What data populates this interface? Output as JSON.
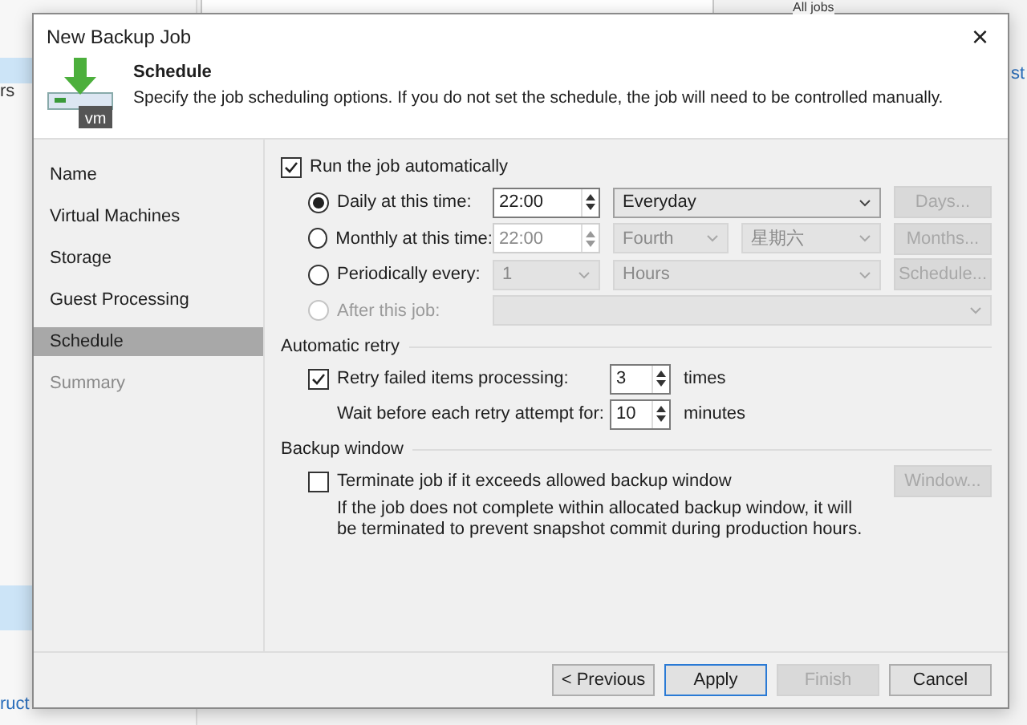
{
  "background": {
    "fragments": [
      {
        "text": "All jobs",
        "kind": "top"
      },
      {
        "text": "rs",
        "kind": "left"
      },
      {
        "text": "st",
        "kind": "right"
      },
      {
        "text": "ruct",
        "kind": "bottom"
      }
    ]
  },
  "window": {
    "title": "New Backup Job",
    "close": "×"
  },
  "header": {
    "logo_text": "vm",
    "title": "Schedule",
    "description": "Specify the job scheduling options. If you do not set the schedule, the job will need to be controlled manually."
  },
  "steps": [
    {
      "label": "Name",
      "selected": false,
      "disabled": false
    },
    {
      "label": "Virtual Machines",
      "selected": false,
      "disabled": false
    },
    {
      "label": "Storage",
      "selected": false,
      "disabled": false
    },
    {
      "label": "Guest Processing",
      "selected": false,
      "disabled": false
    },
    {
      "label": "Schedule",
      "selected": true,
      "disabled": false
    },
    {
      "label": "Summary",
      "selected": false,
      "disabled": true
    }
  ],
  "run_automatically": {
    "label": "Run the job automatically",
    "checked": true
  },
  "schedule_options": [
    {
      "label": "Daily at this time:",
      "selected": true,
      "disabled": false,
      "time": {
        "value": "22:00",
        "disabled": false
      },
      "combos": [
        {
          "value": "Everyday",
          "disabled": false
        }
      ],
      "button": {
        "label": "Days...",
        "disabled": true
      }
    },
    {
      "label": "Monthly at this time:",
      "selected": false,
      "disabled": false,
      "time": {
        "value": "22:00",
        "disabled": true
      },
      "combos": [
        {
          "value": "Fourth",
          "disabled": true
        },
        {
          "value": "星期六",
          "disabled": true
        }
      ],
      "button": {
        "label": "Months...",
        "disabled": true
      }
    },
    {
      "label": "Periodically every:",
      "selected": false,
      "disabled": false,
      "combos": [
        {
          "value": "1",
          "disabled": true
        },
        {
          "value": "Hours",
          "disabled": true
        }
      ],
      "button": {
        "label": "Schedule...",
        "disabled": true
      }
    },
    {
      "label": "After this job:",
      "selected": false,
      "disabled": true,
      "combos": [
        {
          "disabled": true
        }
      ]
    }
  ],
  "retry": {
    "title": "Automatic retry",
    "retry_items": {
      "label": "Retry failed items processing:",
      "checked": true,
      "value": "3",
      "unit": "times"
    },
    "wait": {
      "label": "Wait before each retry attempt for:",
      "value": "10",
      "unit": "minutes"
    }
  },
  "backup_window": {
    "title": "Backup window",
    "terminate": {
      "label": "Terminate job if it exceeds allowed backup window",
      "checked": false
    },
    "note": "If the job does not complete within allocated backup window, it will be terminated to prevent snapshot commit during production hours.",
    "button": {
      "label": "Window...",
      "disabled": true
    }
  },
  "buttons": [
    {
      "label": "< Previous",
      "disabled": false,
      "default": false
    },
    {
      "label": "Apply",
      "disabled": false,
      "default": true
    },
    {
      "label": "Finish",
      "disabled": true,
      "default": false
    },
    {
      "label": "Cancel",
      "disabled": false,
      "default": false
    }
  ]
}
